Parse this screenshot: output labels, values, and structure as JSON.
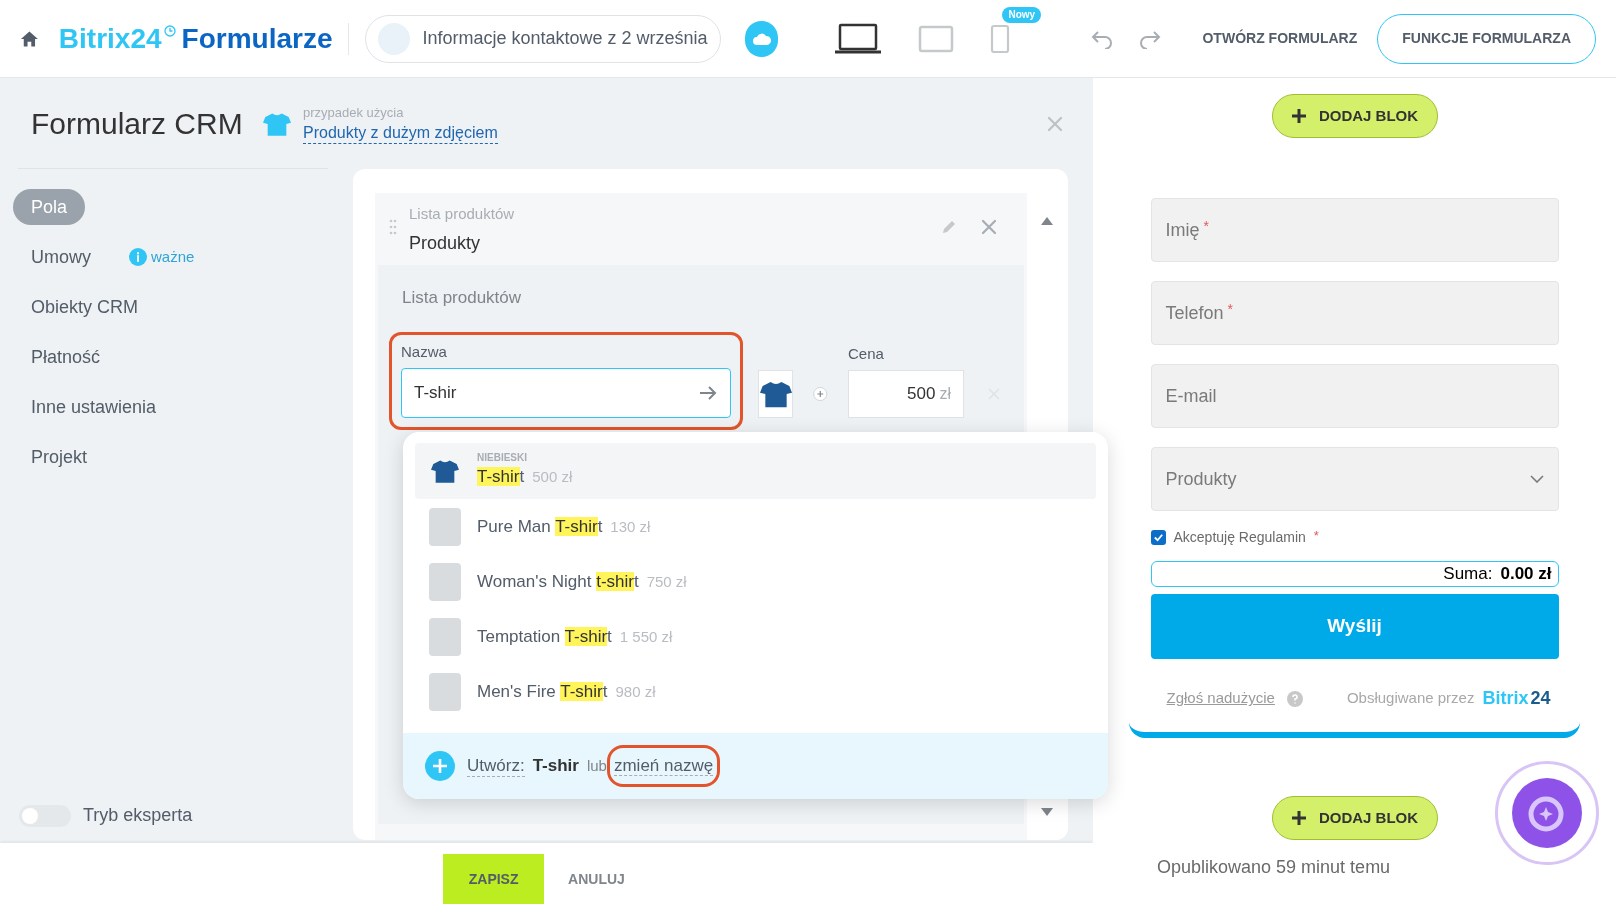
{
  "header": {
    "logo_a": "Bitrix24",
    "logo_b": "Formularze",
    "form_name": "Informacje kontaktowe z 2 września",
    "devices": [
      {
        "kind": "laptop",
        "selected": true
      },
      {
        "kind": "tablet",
        "selected": false
      },
      {
        "kind": "phone",
        "selected": false,
        "badge": "Nowy"
      }
    ],
    "open_link": "OTWÓRZ FORMULARZ",
    "features_button": "FUNKCJE FORMULARZA"
  },
  "panel": {
    "title": "Formularz CRM",
    "use_case_label": "przypadek użycia",
    "use_case_link": "Produkty z dużym zdjęciem"
  },
  "sidebar": {
    "items": [
      {
        "label": "Pola",
        "selected": true
      },
      {
        "label": "Umowy",
        "selected": false,
        "note": "ważne"
      },
      {
        "label": "Obiekty CRM",
        "selected": false
      },
      {
        "label": "Płatność",
        "selected": false
      },
      {
        "label": "Inne ustawienia",
        "selected": false
      },
      {
        "label": "Projekt",
        "selected": false
      }
    ],
    "expert_mode": {
      "label": "Tryb eksperta",
      "on": false
    }
  },
  "field": {
    "type_label": "Lista produktów",
    "name": "Produkty",
    "section_title": "Lista produktów",
    "name_label": "Nazwa",
    "name_value": "T-shir",
    "price_label": "Cena",
    "price_value": "500",
    "currency": "zł"
  },
  "dropdown": {
    "items": [
      {
        "kind": "shirt",
        "group": "NIEBIESKI",
        "match": "T-shir",
        "after": "t",
        "price": "500 zł",
        "selected": true
      },
      {
        "kind": "photo",
        "before": "Pure Man ",
        "match": "T-shir",
        "after": "t",
        "price": "130 zł",
        "selected": false
      },
      {
        "kind": "photo",
        "before": "Woman's Night ",
        "match": "t-shir",
        "after": "t",
        "price": "750 zł",
        "selected": false
      },
      {
        "kind": "photo",
        "before": "Temptation ",
        "match": "T-shir",
        "after": "t",
        "price": "1 550 zł",
        "selected": false
      },
      {
        "kind": "photo",
        "before": "Men's Fire ",
        "match": "T-shir",
        "after": "t",
        "price": "980 zł",
        "selected": false
      }
    ],
    "create_label": "Utwórz:",
    "create_value": "T-shir",
    "or": "lub",
    "rename": "zmień nazwę"
  },
  "footer": {
    "save": "ZAPISZ",
    "cancel": "ANULUJ"
  },
  "preview": {
    "add_block": "DODAJ BLOK",
    "fields": [
      {
        "kind": "text",
        "label": "Imię",
        "required_mark": "*"
      },
      {
        "kind": "text",
        "label": "Telefon",
        "required_mark": "*"
      },
      {
        "kind": "text",
        "label": "E-mail"
      },
      {
        "kind": "select",
        "label": "Produkty"
      }
    ],
    "terms": {
      "label": "Akceptuję Regulamin",
      "checked": true,
      "required_mark": "*"
    },
    "sum_label": "Suma:",
    "sum_value": "0.00 zł",
    "submit": "Wyślij",
    "report": "Zgłoś nadużycie",
    "powered": "Obsługiwane przez",
    "brand_a": "Bitrix",
    "brand_b": "24",
    "add_block_2": "DODAJ BLOK",
    "published": "Opublikowano 59 minut temu"
  }
}
